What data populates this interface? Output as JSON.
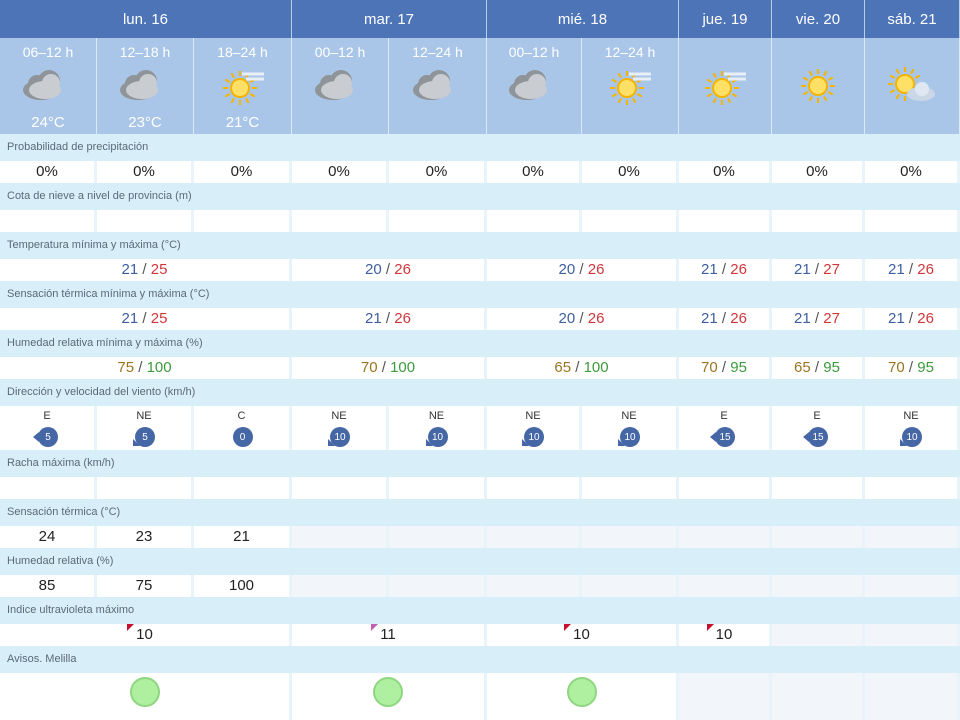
{
  "days": [
    "lun. 16",
    "mar. 17",
    "mié. 18",
    "jue. 19",
    "vie. 20",
    "sáb. 21"
  ],
  "periods": [
    {
      "label": "06–12 h",
      "icon": "cloudy-icon",
      "temp": "24°C"
    },
    {
      "label": "12–18 h",
      "icon": "cloudy-icon",
      "temp": "23°C"
    },
    {
      "label": "18–24 h",
      "icon": "sun-haze-icon",
      "temp": "21°C"
    },
    {
      "label": "00–12 h",
      "icon": "cloudy-icon",
      "temp": ""
    },
    {
      "label": "12–24 h",
      "icon": "cloudy-icon",
      "temp": ""
    },
    {
      "label": "00–12 h",
      "icon": "cloudy-icon",
      "temp": ""
    },
    {
      "label": "12–24 h",
      "icon": "sun-haze-icon",
      "temp": ""
    },
    {
      "label": "",
      "icon": "sun-haze-icon",
      "temp": ""
    },
    {
      "label": "",
      "icon": "sun-icon",
      "temp": ""
    },
    {
      "label": "",
      "icon": "sun-cloud-icon",
      "temp": ""
    }
  ],
  "labels": {
    "precip": "Probabilidad de precipitación",
    "snow": "Cota de nieve a nivel de provincia (m)",
    "temp": "Temperatura mínima y máxima (°C)",
    "feel": "Sensación térmica mínima y máxima (°C)",
    "hum": "Humedad relativa mínima y máxima (%)",
    "wind": "Dirección y velocidad del viento (km/h)",
    "gust": "Racha máxima (km/h)",
    "feel_now": "Sensación térmica (°C)",
    "hum_now": "Humedad relativa (%)",
    "uv": "Indice ultravioleta máximo",
    "warn": "Avisos. Melilla"
  },
  "precip": [
    "0%",
    "0%",
    "0%",
    "0%",
    "0%",
    "0%",
    "0%",
    "0%",
    "0%",
    "0%"
  ],
  "temp_minmax": [
    {
      "min": "21",
      "max": "25"
    },
    {
      "min": "20",
      "max": "26"
    },
    {
      "min": "20",
      "max": "26"
    },
    {
      "min": "21",
      "max": "26"
    },
    {
      "min": "21",
      "max": "27"
    },
    {
      "min": "21",
      "max": "26"
    }
  ],
  "feel_minmax": [
    {
      "min": "21",
      "max": "25"
    },
    {
      "min": "21",
      "max": "26"
    },
    {
      "min": "20",
      "max": "26"
    },
    {
      "min": "21",
      "max": "26"
    },
    {
      "min": "21",
      "max": "27"
    },
    {
      "min": "21",
      "max": "26"
    }
  ],
  "hum_minmax": [
    {
      "min": "75",
      "max": "100"
    },
    {
      "min": "70",
      "max": "100"
    },
    {
      "min": "65",
      "max": "100"
    },
    {
      "min": "70",
      "max": "95"
    },
    {
      "min": "65",
      "max": "95"
    },
    {
      "min": "70",
      "max": "95"
    }
  ],
  "wind": [
    {
      "dir": "E",
      "speed": "5"
    },
    {
      "dir": "NE",
      "speed": "5"
    },
    {
      "dir": "C",
      "speed": "0"
    },
    {
      "dir": "NE",
      "speed": "10"
    },
    {
      "dir": "NE",
      "speed": "10"
    },
    {
      "dir": "NE",
      "speed": "10"
    },
    {
      "dir": "NE",
      "speed": "10"
    },
    {
      "dir": "E",
      "speed": "15"
    },
    {
      "dir": "E",
      "speed": "15"
    },
    {
      "dir": "NE",
      "speed": "10"
    }
  ],
  "feel_now": [
    "24",
    "23",
    "21"
  ],
  "hum_now": [
    "85",
    "75",
    "100"
  ],
  "uv": [
    {
      "value": "10",
      "level": "very-high",
      "color": "#c8102e"
    },
    {
      "value": "11",
      "level": "extreme",
      "color": "#c060b0"
    },
    {
      "value": "10",
      "level": "very-high",
      "color": "#c8102e"
    },
    {
      "value": "10",
      "level": "very-high",
      "color": "#c8102e"
    }
  ],
  "warnings": [
    {
      "level": "green",
      "color": "#aef0a0"
    },
    {
      "level": "green",
      "color": "#aef0a0"
    },
    {
      "level": "green",
      "color": "#aef0a0"
    }
  ]
}
